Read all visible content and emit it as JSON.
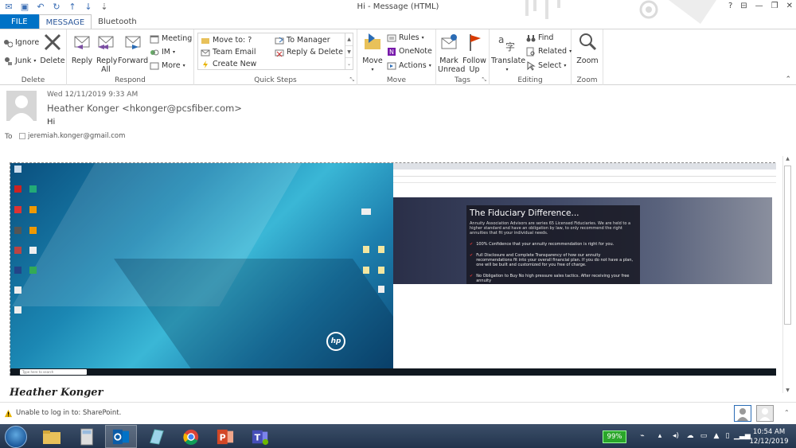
{
  "window": {
    "title": "Hi - Message (HTML)",
    "help": "?",
    "ribbon_options": "⊟",
    "minimize": "—",
    "restore": "❐",
    "close": "✕"
  },
  "qat": {
    "icons": [
      "mail-icon",
      "save-icon",
      "undo-icon",
      "redo-icon",
      "up-arrow-icon",
      "down-arrow-icon",
      "customize-icon"
    ]
  },
  "tabs": [
    "FILE",
    "MESSAGE",
    "Bluetooth"
  ],
  "ribbon": {
    "delete_group": {
      "label": "Delete",
      "ignore": "Ignore",
      "junk": "Junk",
      "delete": "Delete"
    },
    "respond_group": {
      "label": "Respond",
      "reply": "Reply",
      "reply_all": "Reply All",
      "forward": "Forward",
      "meeting": "Meeting",
      "im": "IM",
      "more": "More"
    },
    "quick_steps_group": {
      "label": "Quick Steps",
      "move_to": "Move to: ?",
      "team_email": "Team Email",
      "create_new": "Create New",
      "to_manager": "To Manager",
      "reply_delete": "Reply & Delete"
    },
    "move_group": {
      "label": "Move",
      "move": "Move",
      "rules": "Rules",
      "onenote": "OneNote",
      "actions": "Actions"
    },
    "tags_group": {
      "label": "Tags",
      "mark_unread": "Mark Unread",
      "follow_up": "Follow Up"
    },
    "editing_group": {
      "label": "Editing",
      "translate": "Translate",
      "find": "Find",
      "related": "Related",
      "select": "Select"
    },
    "zoom_group": {
      "label": "Zoom",
      "zoom": "Zoom"
    }
  },
  "message": {
    "datetime": "Wed 12/11/2019 9:33 AM",
    "sender": "Heather Konger <hkonger@pcsfiber.com>",
    "subject": "Hi",
    "to_label": "To",
    "recipient": "jeremiah.konger@gmail.com"
  },
  "embedded": {
    "hero_title": "The Fiduciary Difference...",
    "hero_sub": "Annuity Association Advisors are series 65 Licensed Fiduciaries. We are held to a higher standard and have an obligation by law, to only recommend the right annuities that fit your individual needs.",
    "check1": "100% Confidence that your annuity recommendation is right for you.",
    "check2": "Full Disclosure and Complete Transparency of how our annuity recommendations fit into your overall financial plan. If you do not have a plan, one will be built and customized for you free of charge.",
    "check3": "No Obligation to Buy No high pressure sales tactics. After receiving your free annuity",
    "search_placeholder": "Type here to search",
    "hp_logo": "hp"
  },
  "signature": "Heather Konger",
  "status": {
    "text": "Unable to log in to: SharePoint."
  },
  "taskbar": {
    "battery": "99%",
    "time": "10:54 AM",
    "date": "12/12/2019",
    "apps": [
      "folder-icon",
      "calculator-icon",
      "outlook-icon",
      "notepad-icon",
      "chrome-icon",
      "powerpoint-icon",
      "teams-icon"
    ]
  }
}
